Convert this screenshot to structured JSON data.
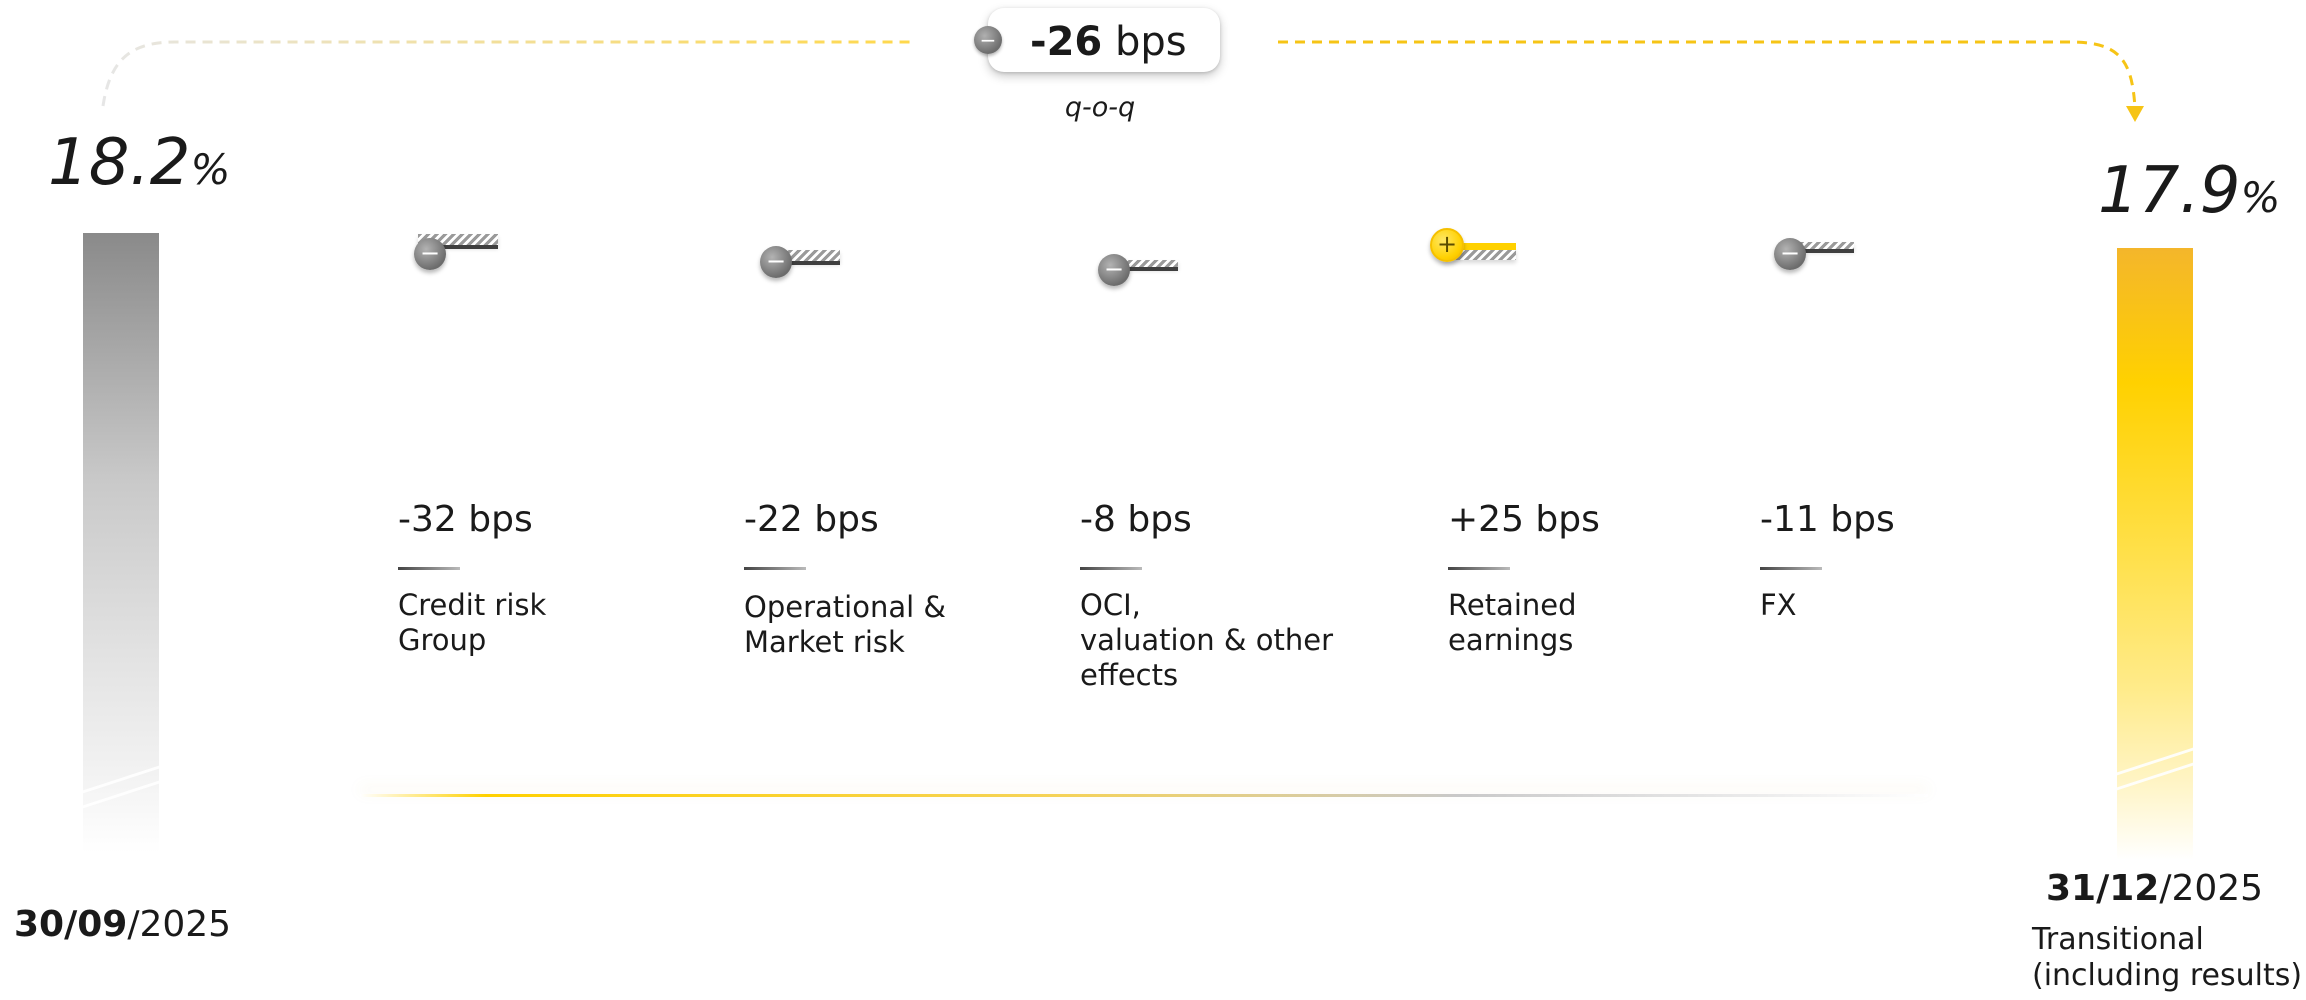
{
  "chart_data": {
    "type": "bar",
    "start": {
      "value": "18.2",
      "unit": "%",
      "date_bold": "30/09",
      "date_rest": "/2025"
    },
    "end": {
      "value": "17.9",
      "unit": "%",
      "date_bold": "31/12",
      "date_rest": "/2025",
      "note_line1": "Transitional",
      "note_line2": "(including results)"
    },
    "total_change": {
      "value": "-26",
      "unit": " bps",
      "sign": "−",
      "period": "q-o-q"
    },
    "steps": [
      {
        "value_text": "-32 bps",
        "value": -32,
        "label_lines": [
          "Credit risk",
          "Group"
        ],
        "sign": "−"
      },
      {
        "value_text": "-22 bps",
        "value": -22,
        "label_lines": [
          "Operational &",
          "Market risk"
        ],
        "sign": "−"
      },
      {
        "value_text": "-8 bps",
        "value": -8,
        "label_lines": [
          "OCI,",
          "valuation & other",
          "effects"
        ],
        "sign": "−"
      },
      {
        "value_text": "+25 bps",
        "value": 25,
        "label_lines": [
          "Retained",
          "earnings"
        ],
        "sign": "+"
      },
      {
        "value_text": "-11 bps",
        "value": -11,
        "label_lines": [
          "FX"
        ],
        "sign": "−"
      }
    ]
  },
  "colors": {
    "accent": "#ffd100",
    "negative": "#7a7a7a",
    "text": "#1a1a1a"
  }
}
